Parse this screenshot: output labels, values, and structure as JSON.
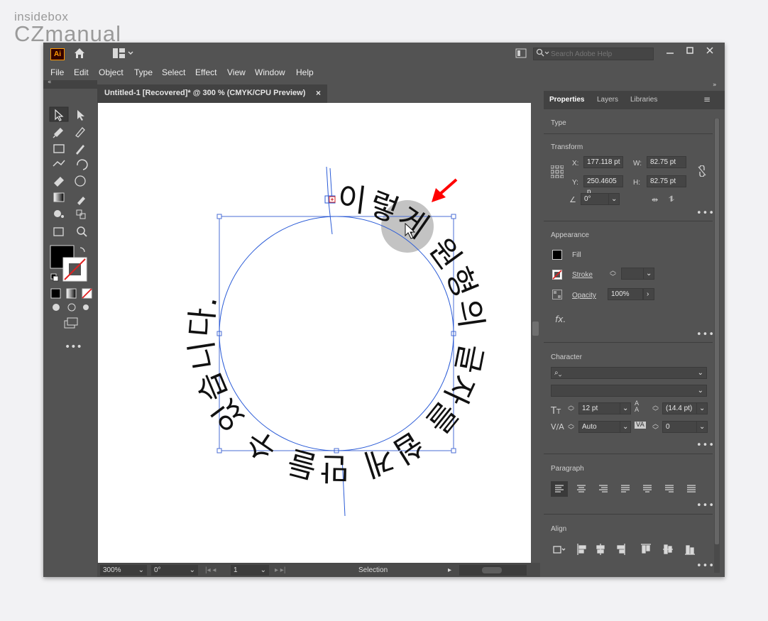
{
  "watermark": {
    "line1": "insidebox",
    "line2": "CZmanual"
  },
  "titlebar": {
    "app_logo": "Ai",
    "search_placeholder": "Search Adobe Help",
    "icons": [
      "home-icon",
      "workspace-icon",
      "search-icon",
      "minimize-icon",
      "restore-icon",
      "close-icon"
    ]
  },
  "menu": [
    "File",
    "Edit",
    "Object",
    "Type",
    "Select",
    "Effect",
    "View",
    "Window",
    "Help"
  ],
  "document": {
    "tab_title": "Untitled-1 [Recovered]* @ 300 % (CMYK/CPU Preview)",
    "tab_close": "×",
    "path_text_before": "이렇게 원형의 글자를 쉽게 만들 수 있습니다.",
    "path_text_display": "이렇게 원형의 글자를 쉽게 만들 수 있습니다."
  },
  "status": {
    "zoom": "300%",
    "rotation": "0°",
    "artboard": "1",
    "tool": "Selection"
  },
  "properties": {
    "tabs": [
      "Properties",
      "Layers",
      "Libraries"
    ],
    "type_label": "Type",
    "transform": {
      "title": "Transform",
      "x_label": "X:",
      "x": "177.118 pt",
      "y_label": "Y:",
      "y": "250.4605 p",
      "w_label": "W:",
      "w": "82.75 pt",
      "h_label": "H:",
      "h": "82.75 pt",
      "angle": "0°"
    },
    "appearance": {
      "title": "Appearance",
      "fill": "Fill",
      "stroke": "Stroke",
      "opacity_label": "Opacity",
      "opacity": "100%"
    },
    "character": {
      "title": "Character",
      "font_size": "12 pt",
      "leading": "(14.4 pt)",
      "kerning": "Auto",
      "tracking": "0"
    },
    "paragraph": {
      "title": "Paragraph"
    },
    "align": {
      "title": "Align"
    }
  },
  "colors": {
    "accent_arrow": "#ff0000",
    "path_blue": "#2a5bd7",
    "highlight": "#bdbdbd"
  }
}
